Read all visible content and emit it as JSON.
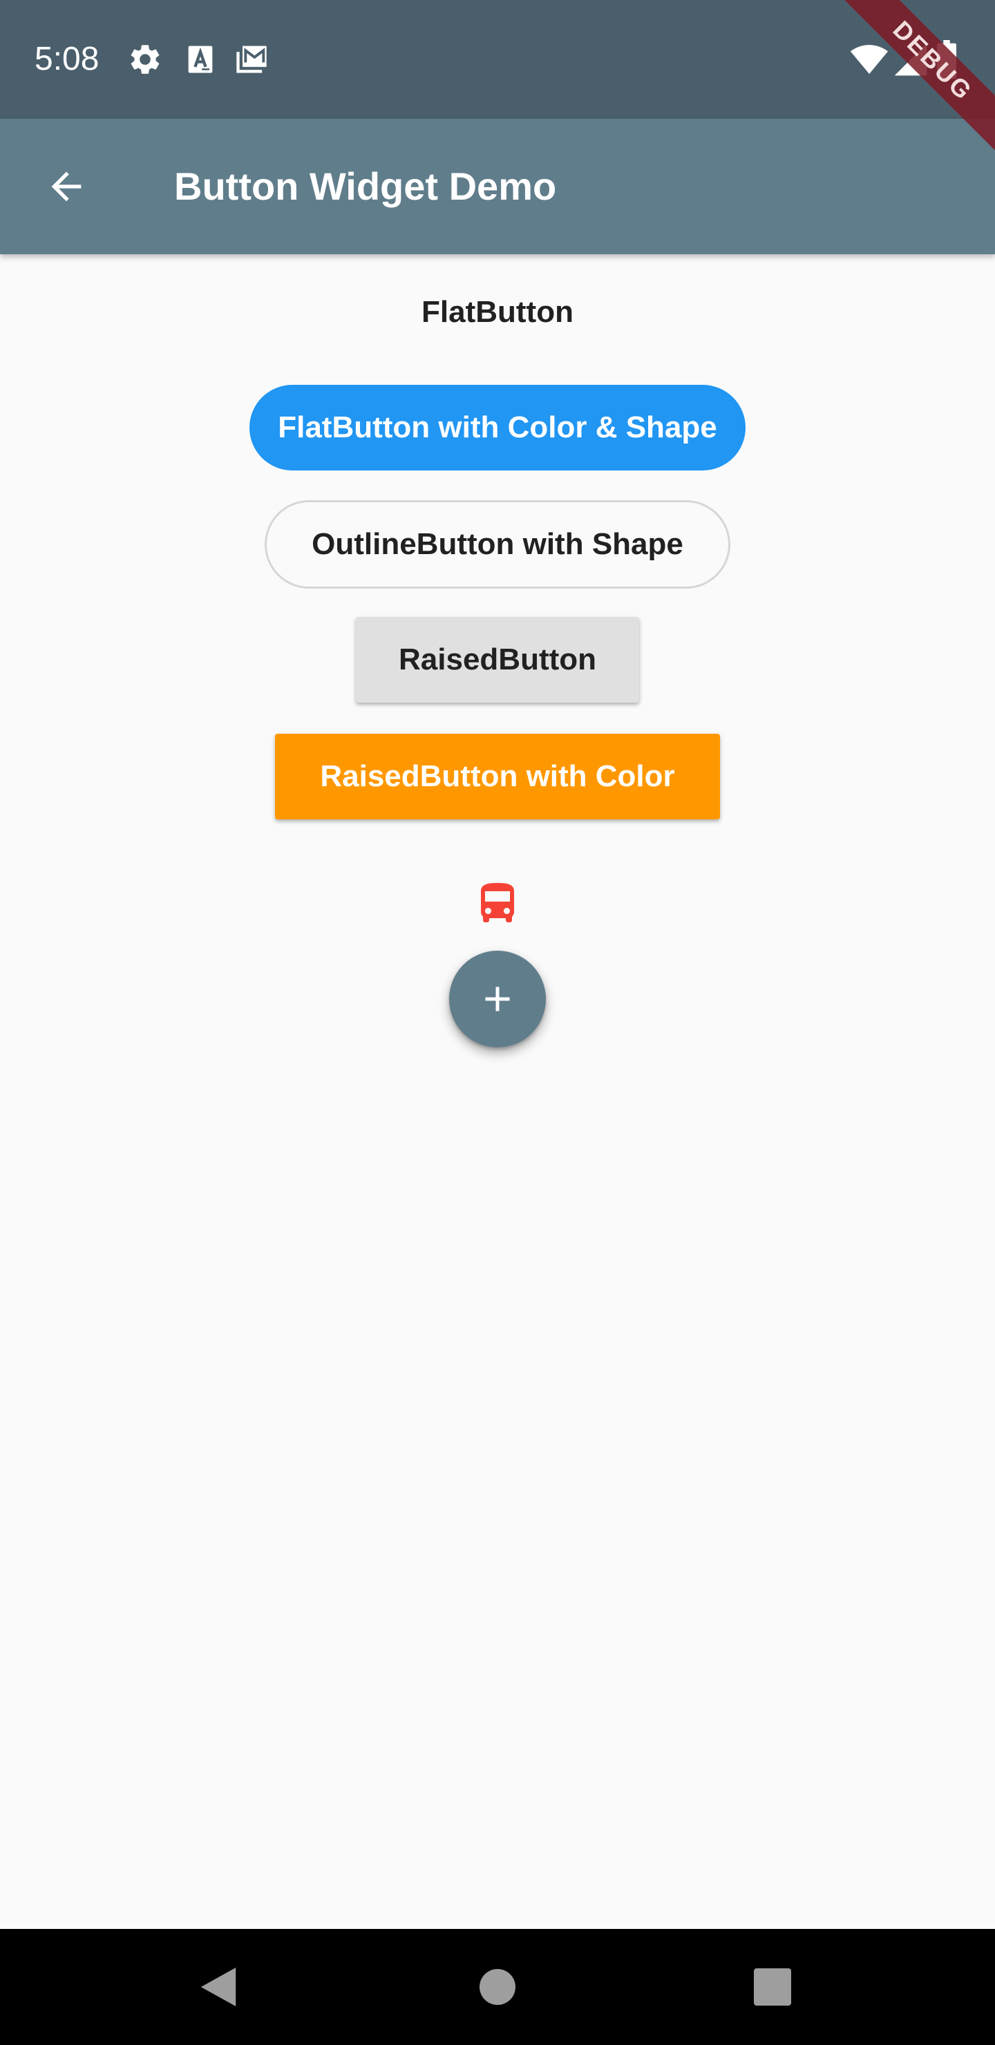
{
  "status_bar": {
    "time": "5:08",
    "left_icons": [
      "settings-gear-icon",
      "text-a-icon",
      "gmail-icon"
    ],
    "right_icons": [
      "wifi-icon",
      "signal-icon",
      "battery-icon"
    ],
    "background": "#4a5f6b"
  },
  "debug_banner": {
    "label": "DEBUG"
  },
  "app_bar": {
    "title": "Button Widget Demo",
    "back_icon": "arrow-back-icon",
    "background": "#607d8b"
  },
  "main": {
    "flat_button_label": "FlatButton",
    "flat_color_shape_button_label": "FlatButton with Color & Shape",
    "outline_shape_button_label": "OutlineButton with Shape",
    "raised_button_label": "RaisedButton",
    "raised_color_button_label": "RaisedButton with Color",
    "icon_button": "directions-bus-icon",
    "fab_icon": "add-icon"
  },
  "colors": {
    "primary": "#607d8b",
    "flat_button": "#2196f3",
    "raised_button": "#e0e0e0",
    "raised_color_button": "#ff9800",
    "bus_icon": "#f44336",
    "background": "#fafafa"
  },
  "nav_bar": {
    "icons": [
      "back-triangle-icon",
      "home-circle-icon",
      "recents-square-icon"
    ]
  }
}
